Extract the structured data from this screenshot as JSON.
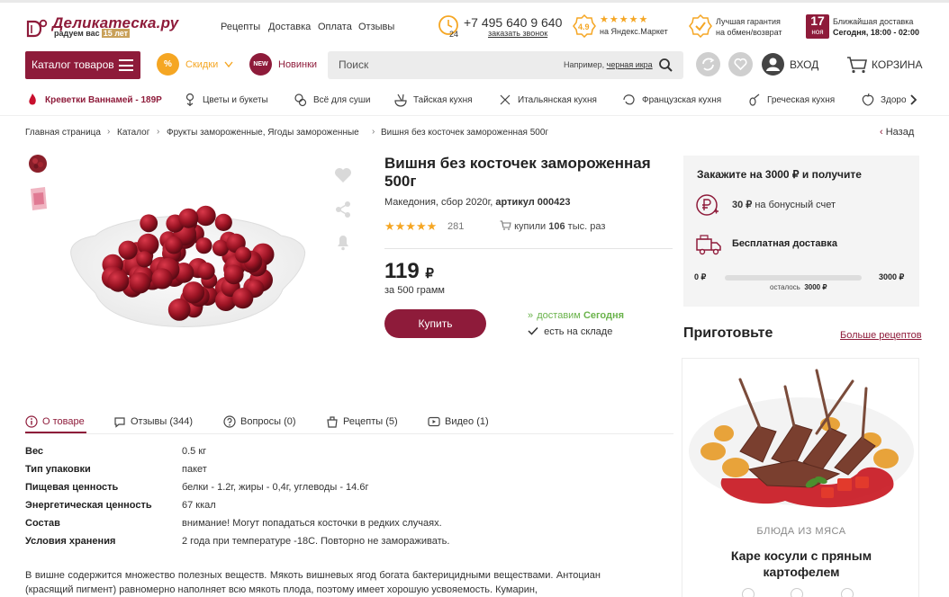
{
  "header": {
    "logo_name": "Деликатеска.ру",
    "logo_tagline": "радуем вас",
    "logo_years": "15 лет",
    "nav": [
      "Рецепты",
      "Доставка",
      "Оплата",
      "Отзывы"
    ],
    "phone": "+7 495 640 9 640",
    "phone_badge": "24",
    "callback": "заказать звонок",
    "rating": "4.9",
    "rating_stars": "★★★★★",
    "rating_source": "на Яндекс.Маркет",
    "guarantee_line1": "Лучшая гарантия",
    "guarantee_line2": "на обмен/возврат",
    "delivery_day": "17",
    "delivery_month": "ноя",
    "delivery_title": "Ближайшая доставка",
    "delivery_time": "Сегодня, 18:00 - 02:00"
  },
  "toolbar": {
    "catalog_label": "Каталог товаров",
    "discounts_badge": "%",
    "discounts_label": "Скидки",
    "new_badge": "NEW",
    "new_label": "Новинки",
    "search_placeholder": "Поиск",
    "search_example_prefix": "Например,",
    "search_example_link": "черная икра",
    "login_label": "ВХОД",
    "cart_label": "КОРЗИНА"
  },
  "categories": [
    {
      "label": "Креветки Ваннамей - 189Р",
      "icon": "shrimp-icon",
      "highlight": true
    },
    {
      "label": "Цветы и букеты",
      "icon": "flowers-icon"
    },
    {
      "label": "Всё для суши",
      "icon": "sushi-icon"
    },
    {
      "label": "Тайская кухня",
      "icon": "thai-icon"
    },
    {
      "label": "Итальянская кухня",
      "icon": "italian-icon"
    },
    {
      "label": "Французская кухня",
      "icon": "french-icon"
    },
    {
      "label": "Греческая кухня",
      "icon": "greek-icon"
    },
    {
      "label": "Здоров",
      "icon": "healthy-icon"
    }
  ],
  "breadcrumb": {
    "items": [
      "Главная страница",
      "Каталог",
      "Фрукты замороженные, Ягоды замороженные",
      "Вишня без косточек замороженная 500г"
    ],
    "back": "Назад"
  },
  "product": {
    "title": "Вишня без косточек замороженная 500г",
    "origin": "Македония, сбор 2020г,",
    "article_label": "артикул",
    "article": "000423",
    "stars": "★★★★★",
    "reviews_count": "281",
    "bought_prefix": "купили",
    "bought_count": "106",
    "bought_suffix": "тыс. раз",
    "price": "119",
    "currency": "₽",
    "per_unit": "за 500 грамм",
    "buy_label": "Купить",
    "delivery_prefix": "доставим",
    "delivery_when": "Сегодня",
    "stock": "есть на складе"
  },
  "promo": {
    "title": "Закажите на 3000 ₽ и получите",
    "bonus_amount": "30 ₽",
    "bonus_text": "на бонусный счет",
    "free_delivery": "Бесплатная доставка",
    "min": "0 ₽",
    "max": "3000 ₽",
    "remaining_label": "осталось",
    "remaining": "3000 ₽",
    "progress": 0
  },
  "recipes": {
    "title": "Приготовьте",
    "more": "Больше рецептов",
    "category": "БЛЮДА ИЗ МЯСА",
    "name": "Каре косули с пряным картофелем"
  },
  "tabs": [
    {
      "label": "О товаре",
      "icon": "info-icon",
      "active": true
    },
    {
      "label": "Отзывы (344)",
      "icon": "comment-icon"
    },
    {
      "label": "Вопросы (0)",
      "icon": "question-icon"
    },
    {
      "label": "Рецепты (5)",
      "icon": "recipe-icon"
    },
    {
      "label": "Видео (1)",
      "icon": "video-icon"
    }
  ],
  "specs": [
    {
      "key": "Вес",
      "value": "0.5 кг"
    },
    {
      "key": "Тип упаковки",
      "value": "пакет"
    },
    {
      "key": "Пищевая ценность",
      "value": "белки - 1.2г, жиры - 0,4г, углеводы - 14.6г"
    },
    {
      "key": "Энергетическая ценность",
      "value": "67 ккал"
    },
    {
      "key": "Состав",
      "value": "внимание! Могут попадаться косточки в редких случаях."
    },
    {
      "key": "Условия хранения",
      "value": "2 года при температуре -18С. Повторно не замораживать."
    }
  ],
  "description": "В вишне содержится множество полезных веществ. Мякоть вишневых ягод богата бактерицидными веществами. Антоциан (красящий пигмент) равномерно наполняет всю мякоть плода, поэтому имеет хорошую усвояемость. Кумарин,",
  "colors": {
    "brand": "#8e1b3a",
    "accent_orange": "#f5a623",
    "green": "#6ab34b"
  }
}
